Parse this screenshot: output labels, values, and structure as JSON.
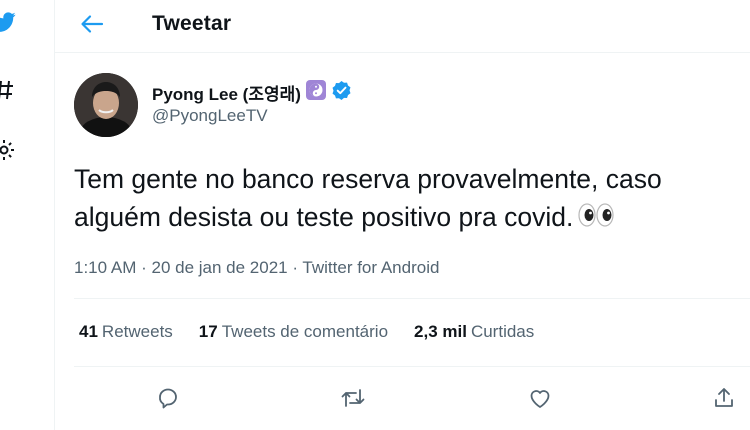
{
  "header": {
    "title": "Tweetar"
  },
  "tweet": {
    "author_name": "Pyong Lee (조영래)",
    "author_handle": "@PyongLeeTV",
    "text": "Tem gente no banco reserva provavelmente, caso alguém desista ou teste positivo pra covid.",
    "time": "1:10 AM",
    "date": "20 de jan de 2021",
    "source": "Twitter for Android",
    "stats": {
      "retweets_count": "41",
      "retweets_label": "Retweets",
      "quotes_count": "17",
      "quotes_label": "Tweets de comentário",
      "likes_count": "2,3 mil",
      "likes_label": "Curtidas"
    }
  },
  "colors": {
    "accent": "#1d9bf0",
    "text": "#0f1419",
    "secondary": "#536471",
    "divider": "#eff3f4",
    "badge_purple": "#9f85d6"
  },
  "icons": [
    "twitter-bird-icon",
    "hashtag-icon",
    "gear-icon",
    "back-arrow-icon",
    "yin-yang-icon",
    "verified-badge-icon",
    "eyes-emoji-icon",
    "reply-icon",
    "retweet-icon",
    "like-icon",
    "share-icon"
  ]
}
